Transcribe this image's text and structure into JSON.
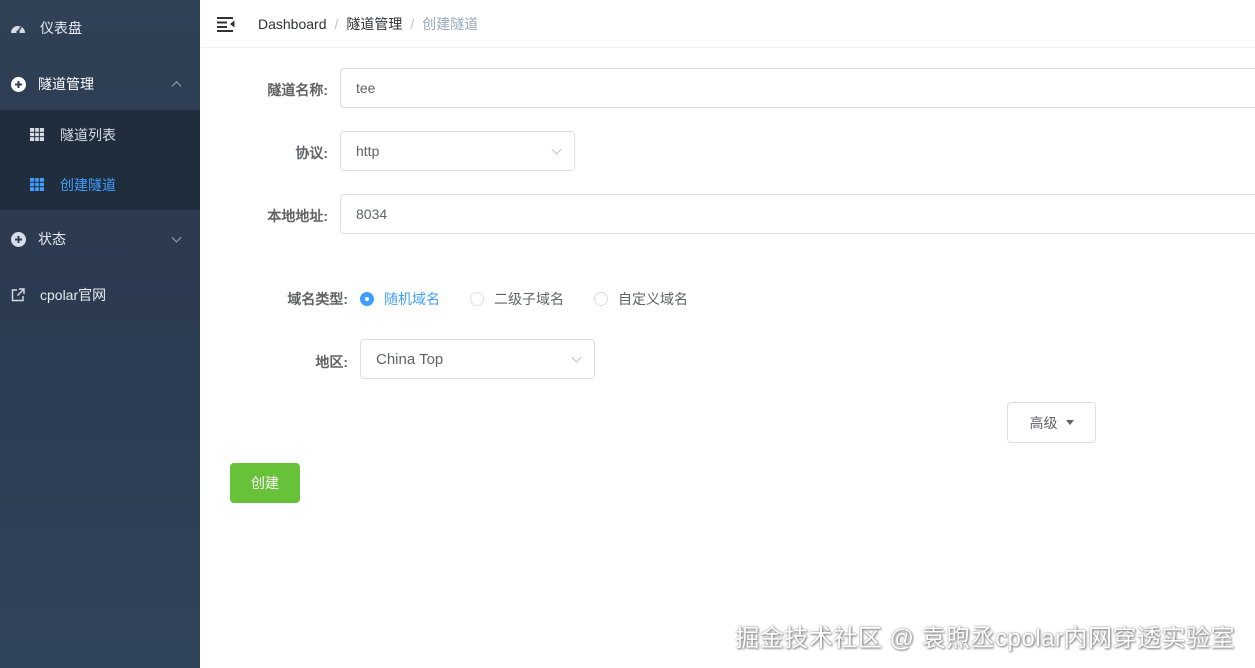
{
  "sidebar": {
    "dashboard": {
      "label": "仪表盘",
      "icon": "dashboard-icon"
    },
    "tunnel_mgmt": {
      "label": "隧道管理",
      "icon": "circle-plus-icon"
    },
    "sub_items": [
      {
        "label": "隧道列表",
        "icon": "grid-icon",
        "active": false
      },
      {
        "label": "创建隧道",
        "icon": "grid-icon",
        "active": true
      }
    ],
    "status": {
      "label": "状态",
      "icon": "circle-plus-icon"
    },
    "website": {
      "label": "cpolar官网",
      "icon": "external-link-icon"
    }
  },
  "header": {
    "breadcrumb": [
      "Dashboard",
      "隧道管理",
      "创建隧道"
    ]
  },
  "form": {
    "tunnel_name": {
      "label": "隧道名称:",
      "value": "tee"
    },
    "protocol": {
      "label": "协议:",
      "value": "http"
    },
    "local_addr": {
      "label": "本地地址:",
      "value": "8034"
    },
    "domain_type": {
      "label": "域名类型:",
      "options": [
        {
          "label": "随机域名",
          "checked": true
        },
        {
          "label": "二级子域名",
          "checked": false
        },
        {
          "label": "自定义域名",
          "checked": false
        }
      ]
    },
    "region": {
      "label": "地区:",
      "value": "China Top"
    },
    "advanced_label": "高级",
    "create_label": "创建"
  },
  "watermark": "掘金技术社区 @ 袁煦丞cpolar内网穿透实验室",
  "colors": {
    "sidebar_bg": "#304156",
    "submenu_bg": "#1f2d3d",
    "accent": "#409eff",
    "create_button": "#67c23a"
  }
}
